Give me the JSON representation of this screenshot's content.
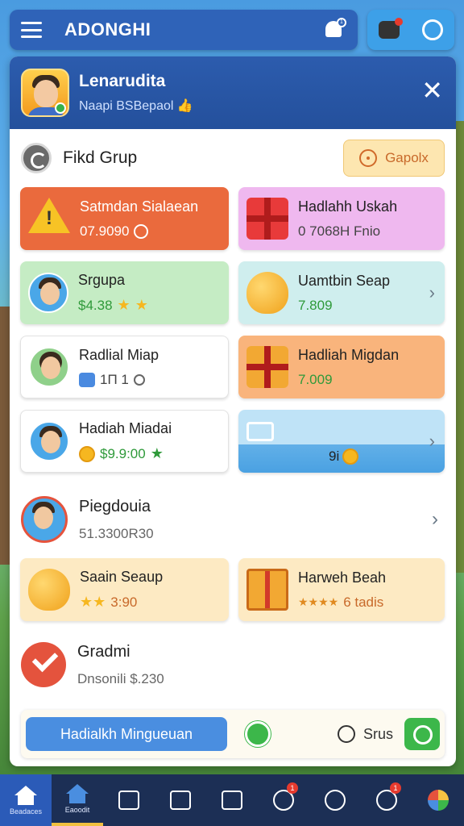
{
  "topbar": {
    "title": "ADONGHI",
    "bell_badge": "1"
  },
  "panel": {
    "username": "Lenarudita",
    "subtitle": "Naapi BSBepaol",
    "group": {
      "title": "Fikd Grup",
      "button": "Gapolx"
    },
    "cards": [
      {
        "title": "Satmdan Sialaean",
        "value": "07.9090"
      },
      {
        "title": "Hadlahh Uskah",
        "value": "0 7068H Fnio"
      },
      {
        "title": "Srgupa",
        "value": "$4.38"
      },
      {
        "title": "Uamtbin Seap",
        "value": "7.809"
      },
      {
        "title": "Radlial Miap",
        "value": "1П 1"
      },
      {
        "title": "Hadliah Migdan",
        "value": "7.009"
      },
      {
        "title": "Hadiah Miadai",
        "value": "$9.9:00"
      },
      {
        "title": "",
        "value": "9i"
      }
    ],
    "row1": {
      "title": "Piegdouia",
      "subtitle": "51.3300R30"
    },
    "cards2": [
      {
        "title": "Saain Seaup",
        "value": "3:90"
      },
      {
        "title": "Harweh Beah",
        "value": "6 tadis"
      }
    ],
    "row2": {
      "title": "Gradmi",
      "subtitle": "Dnsonili $.230"
    },
    "bottom": {
      "main_button": "Hadialkh Mingueuan",
      "sync_label": "Srus"
    }
  },
  "nav": {
    "items": [
      {
        "label": "Beadaces",
        "icon": "home-icon"
      },
      {
        "label": "Eaoodit",
        "icon": "home-icon"
      },
      {
        "label": "",
        "icon": "grid-icon"
      },
      {
        "label": "",
        "icon": "list-icon"
      },
      {
        "label": "",
        "icon": "calendar-icon"
      },
      {
        "label": "",
        "icon": "chat-icon",
        "badge": "1"
      },
      {
        "label": "",
        "icon": "gear-icon"
      },
      {
        "label": "",
        "icon": "chat-icon",
        "badge": "1"
      },
      {
        "label": "",
        "icon": "globe-icon"
      }
    ]
  }
}
